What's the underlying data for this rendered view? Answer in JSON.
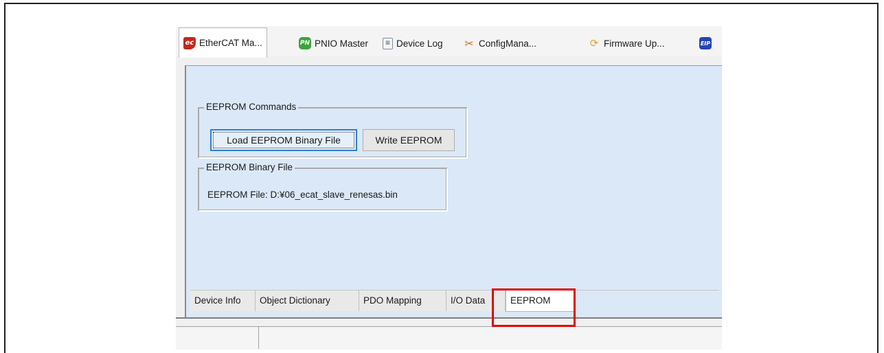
{
  "top_tabs": [
    {
      "label": "EtherCAT Ma...",
      "icon": "ethercat-icon"
    },
    {
      "label": "PNIO Master",
      "icon": "pnio-icon"
    },
    {
      "label": "Device Log",
      "icon": "clipboard-icon"
    },
    {
      "label": "ConfigMana...",
      "icon": "tools-icon"
    },
    {
      "label": "Firmware Up...",
      "icon": "firmware-update-icon"
    },
    {
      "label": "",
      "icon": "eip-icon"
    }
  ],
  "icon_glyphs": {
    "ethercat": "ec",
    "pnio": "PN",
    "clipboard": "≡",
    "tools": "✂",
    "firmware": "⟳",
    "eip": "EIP"
  },
  "eeprom_commands": {
    "title": "EEPROM Commands",
    "load_button": "Load EEPROM Binary File",
    "write_button": "Write EEPROM"
  },
  "eeprom_file": {
    "title": "EEPROM Binary File",
    "label": "EEPROM File:",
    "path": "D:¥06_ecat_slave_renesas.bin"
  },
  "bottom_tabs": [
    {
      "label": "Device Info"
    },
    {
      "label": "Object Dictionary"
    },
    {
      "label": "PDO Mapping"
    },
    {
      "label": "I/O Data"
    },
    {
      "label": "EEPROM",
      "active": true
    }
  ],
  "colors": {
    "panel_bg": "#dbe8f7",
    "highlight": "#e00000",
    "focus": "#2f7fd1"
  }
}
